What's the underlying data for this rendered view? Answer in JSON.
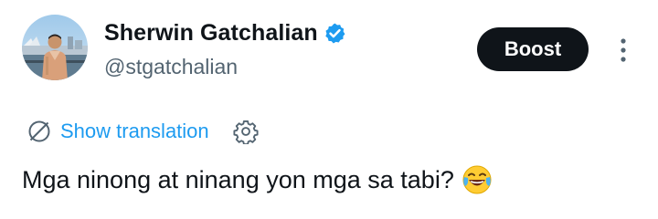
{
  "author": {
    "display_name": "Sherwin Gatchalian",
    "handle": "@stgatchalian",
    "verified": true,
    "verified_color": "#1d9bf0"
  },
  "actions": {
    "boost_label": "Boost",
    "more_icon": "more-vertical-icon"
  },
  "translation": {
    "label": "Show translation",
    "icon": "globe-icon",
    "settings_icon": "gear-icon",
    "link_color": "#1d9bf0"
  },
  "tweet": {
    "text": "Mga ninong at ninang yon mga sa tabi?",
    "emoji": "face-with-tears-of-joy-emoji"
  }
}
